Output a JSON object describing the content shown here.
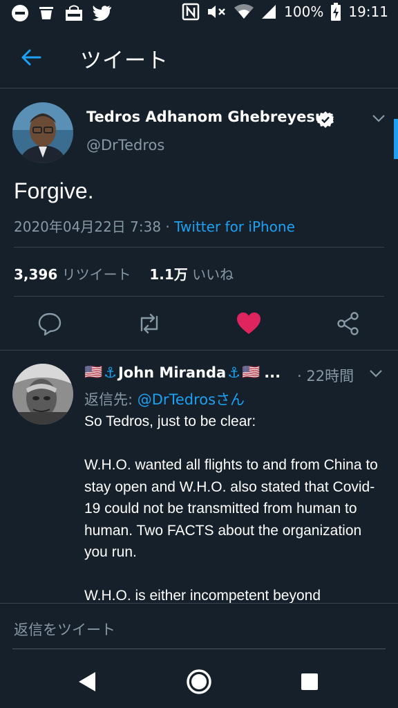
{
  "status_bar": {
    "battery": "100%",
    "time": "19:11",
    "left_icons": [
      "minus-circle-icon",
      "cup-icon",
      "market-icon",
      "twitter-bird-icon"
    ],
    "right_icons": [
      "nfc-icon",
      "mute-icon",
      "wifi-icon",
      "signal-icon",
      "battery-charging-icon"
    ]
  },
  "header": {
    "title": "ツイート"
  },
  "tweet": {
    "author_name": "Tedros Adhanom Ghebreyesus",
    "handle": "@DrTedros",
    "text": "Forgive.",
    "timestamp": "2020年04月22日 7:38 · ",
    "source": "Twitter for iPhone",
    "retweet_count": "3,396",
    "retweet_label": "リツイート",
    "like_count": "1.1万",
    "like_label": "いいね"
  },
  "reply": {
    "flag_left": "🇺🇸",
    "anchor_left": "⚓",
    "name": "John Miranda",
    "anchor_right": "⚓",
    "flag_right": "🇺🇸",
    "ellipsis": "...",
    "time": "· 22時間",
    "reply_to_label": "返信先: ",
    "reply_to_handle": "@DrTedrosさん",
    "body": [
      "So Tedros, just to be clear:",
      "W.H.O. wanted all flights to and from China to stay open and W.H.O. also stated that Covid-19 could not be transmitted from human to human. Two FACTS about the organization you run.",
      "W.H.O. is either incompetent beyond"
    ]
  },
  "compose": {
    "placeholder": "返信をツイート"
  },
  "colors": {
    "background": "#15202b",
    "accent": "#1da1f2",
    "secondary_text": "#8899a6",
    "like": "#e0245e",
    "divider": "#38444d"
  }
}
